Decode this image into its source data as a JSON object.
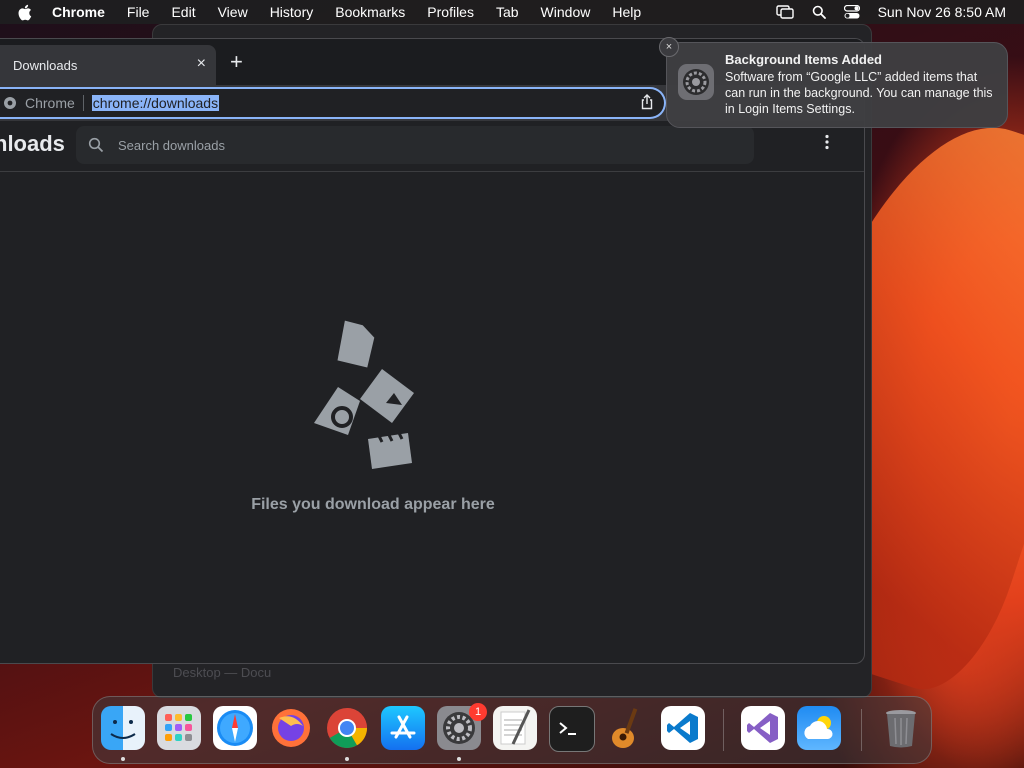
{
  "menubar": {
    "app_name": "Chrome",
    "items": [
      "File",
      "Edit",
      "View",
      "History",
      "Bookmarks",
      "Profiles",
      "Tab",
      "Window",
      "Help"
    ],
    "clock": "Sun Nov 26  8:50 AM"
  },
  "background_window": {
    "ghost_text": "Desktop — Docu"
  },
  "browser": {
    "tab_title": "Downloads",
    "tab_close": "×",
    "new_tab": "+",
    "omnibox_chip": "Chrome",
    "url": "chrome://downloads",
    "page_title": "nloads",
    "search_placeholder": "Search downloads",
    "empty_message": "Files you download appear here"
  },
  "notification": {
    "close": "×",
    "title": "Background Items Added",
    "body": "Software from “Google LLC” added items that can run in the background. You can manage this in Login Items Settings."
  },
  "dock": {
    "apps": [
      "Finder",
      "Launchpad",
      "Safari",
      "Firefox",
      "Google Chrome",
      "App Store",
      "System Settings",
      "TextEdit",
      "Terminal",
      "GarageBand",
      "Visual Studio Code",
      "Visual Studio",
      "Weather",
      "Trash"
    ],
    "settings_badge": "1"
  },
  "colors": {
    "accent": "#8ab4f8",
    "page_bg": "#202124",
    "badge": "#ff3b30"
  }
}
